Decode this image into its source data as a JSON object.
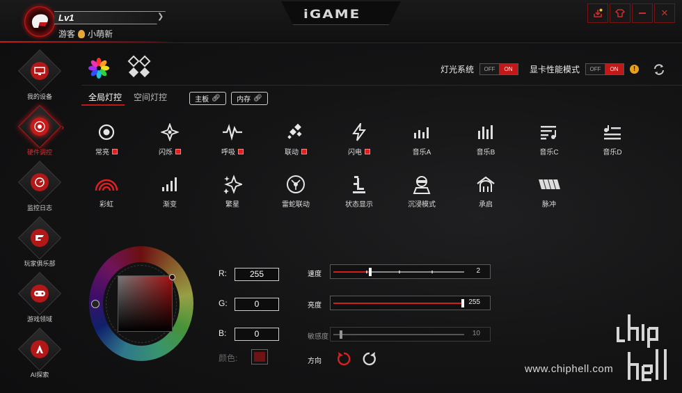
{
  "header": {
    "level": "Lv1",
    "user_role": "游客",
    "username": "小萌新",
    "brand": "iGAME",
    "window_buttons": [
      "notification-icon",
      "skin-icon",
      "minimize-icon",
      "close-icon"
    ]
  },
  "sidebar": {
    "items": [
      {
        "label": "我的设备",
        "icon": "monitor-icon"
      },
      {
        "label": "硬件调控",
        "icon": "target-icon",
        "active": true
      },
      {
        "label": "监控日志",
        "icon": "gauge-icon"
      },
      {
        "label": "玩家俱乐部",
        "icon": "igame-logo-icon"
      },
      {
        "label": "游戏领域",
        "icon": "gamepad-icon"
      },
      {
        "label": "AI探索",
        "icon": "ai-icon"
      }
    ]
  },
  "toolbar": {
    "lighting_label": "灯光系统",
    "perf_label": "显卡性能模式",
    "toggle_off": "OFF",
    "toggle_on": "ON"
  },
  "tabs": {
    "global": "全局灯控",
    "spatial": "空间灯控",
    "board_btn": "主板",
    "memory_btn": "内存"
  },
  "effects": [
    {
      "label": "常亮",
      "icon": "steady-icon",
      "marker": true
    },
    {
      "label": "闪烁",
      "icon": "blink-icon",
      "marker": true
    },
    {
      "label": "呼吸",
      "icon": "breath-icon",
      "marker": true
    },
    {
      "label": "联动",
      "icon": "link-icon",
      "marker": true
    },
    {
      "label": "闪电",
      "icon": "lightning-icon",
      "marker": true
    },
    {
      "label": "音乐A",
      "icon": "music-a-icon"
    },
    {
      "label": "音乐B",
      "icon": "music-b-icon"
    },
    {
      "label": "音乐C",
      "icon": "music-c-icon"
    },
    {
      "label": "音乐D",
      "icon": "music-d-icon"
    },
    {
      "label": "彩虹",
      "icon": "rainbow-icon"
    },
    {
      "label": "渐变",
      "icon": "gradient-icon"
    },
    {
      "label": "繁星",
      "icon": "stars-icon"
    },
    {
      "label": "雷蛇联动",
      "icon": "razer-icon"
    },
    {
      "label": "状态显示",
      "icon": "status-icon"
    },
    {
      "label": "沉浸模式",
      "icon": "immersive-icon"
    },
    {
      "label": "承启",
      "icon": "inherit-icon"
    },
    {
      "label": "脉冲",
      "icon": "pulse-icon"
    }
  ],
  "color": {
    "r_label": "R:",
    "r": "255",
    "g_label": "G:",
    "g": "0",
    "b_label": "B:",
    "b": "0",
    "swatch_label": "颜色:",
    "swatch_color": "#6e1313"
  },
  "sliders": {
    "speed": {
      "label": "速度",
      "value": "2",
      "position": 0.27
    },
    "brightness": {
      "label": "亮度",
      "value": "255",
      "position": 1.0
    },
    "sensitivity": {
      "label": "敏感度",
      "value": "10",
      "position": 0.05
    }
  },
  "direction": {
    "label": "方向"
  },
  "watermark": {
    "url": "www.chiphell.com",
    "logo": "chip hell"
  }
}
